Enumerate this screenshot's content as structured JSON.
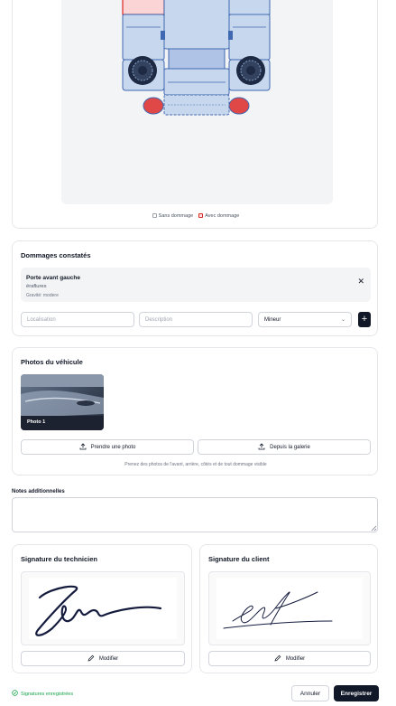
{
  "diagram": {
    "legend_no_damage": "Sans dommage",
    "legend_damage": "Avec dommage",
    "damage_color": "#dc2626",
    "panel_color": "#c7d7ee",
    "panel_border": "#4068b0"
  },
  "damages": {
    "title": "Dommages constatés",
    "items": [
      {
        "name": "Porte avant gauche",
        "type": "éraflures",
        "severity": "Gravité: modere"
      }
    ],
    "remove_icon": "close-icon",
    "location_placeholder": "Localisation",
    "description_placeholder": "Description",
    "severity_value": "Mineur",
    "add_label": "+"
  },
  "photos": {
    "title": "Photos du véhicule",
    "items": [
      {
        "label": "Photo 1"
      }
    ],
    "take_photo_label": "Prendre une photo",
    "gallery_label": "Depuis la galerie",
    "hint": "Prenez des photos de l'avant, arrière, côtés et de tout dommage visible"
  },
  "notes": {
    "label": "Notes additionnelles",
    "value": ""
  },
  "signatures": {
    "technician_title": "Signature du technicien",
    "client_title": "Signature du client",
    "edit_label": "Modifier"
  },
  "footer": {
    "status": "Signatures enregistrées",
    "status_color": "#16a34a",
    "cancel_label": "Annuler",
    "save_label": "Enregistrer"
  }
}
